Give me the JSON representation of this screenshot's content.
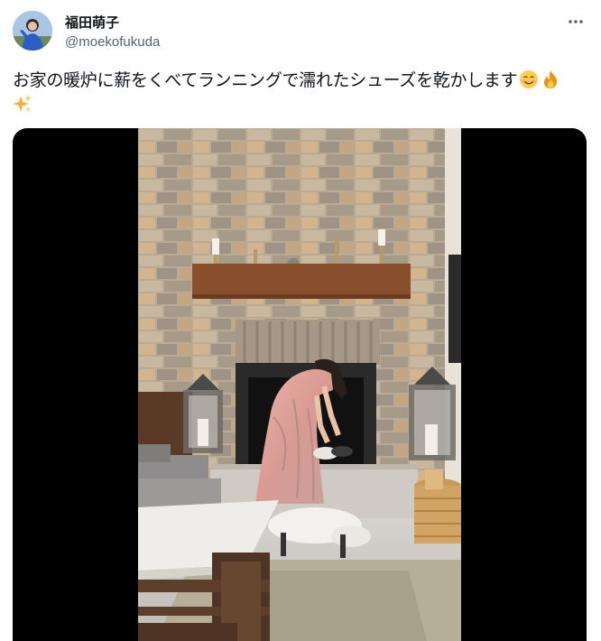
{
  "user": {
    "display_name": "福田萌子",
    "handle": "@moekofukuda"
  },
  "tweet": {
    "text": "お家の暖炉に薪をくべてランニングで濡れたシューズを乾かします",
    "emojis": [
      "smiling-face-icon",
      "fire-icon",
      "sparkles-icon"
    ]
  },
  "media": {
    "type": "video",
    "description_icon": "video-thumbnail"
  },
  "colors": {
    "text": "#0f1419",
    "secondary": "#536471",
    "media_bg": "#000000"
  }
}
